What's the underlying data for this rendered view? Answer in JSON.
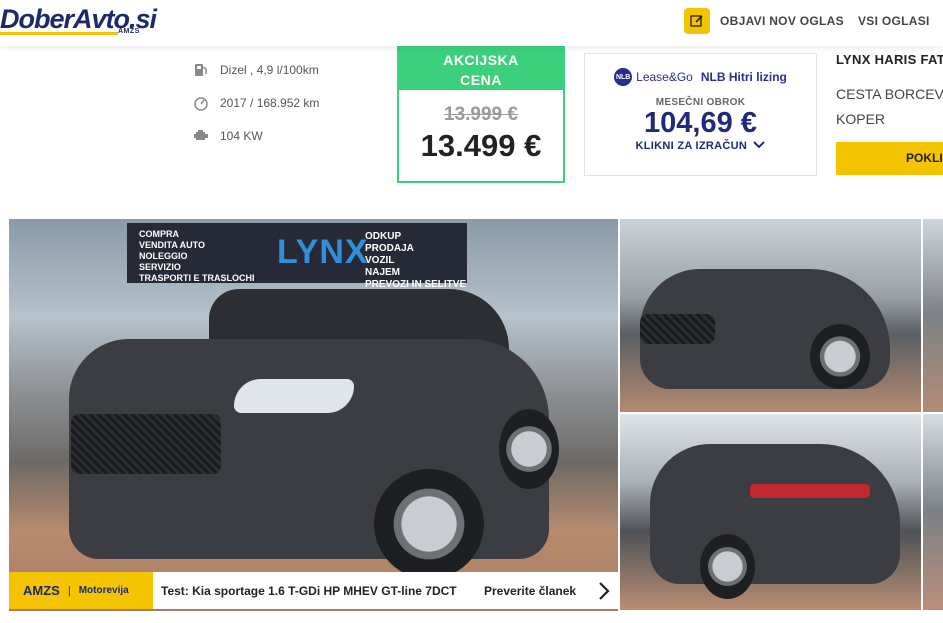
{
  "header": {
    "logo_text": "DoberAvto.si",
    "logo_sub": "AMZS",
    "post_ad_label": "OBJAVI NOV OGLAS",
    "all_ads_label": "VSI OGLASI"
  },
  "specs": [
    {
      "icon": "fuel-pump-icon",
      "text": "Dizel , 4,9 l/100km"
    },
    {
      "icon": "speedometer-icon",
      "text": "2017 / 168.952 km"
    },
    {
      "icon": "engine-icon",
      "text": "104 KW"
    }
  ],
  "price": {
    "promo_line1": "AKCIJSKA",
    "promo_line2": "CENA",
    "old_price": "13.999 €",
    "new_price": "13.499 €"
  },
  "leasing": {
    "brand_logo": "NLB",
    "brand_text": "Lease&Go",
    "product": "NLB Hitri lizing",
    "monthly_label": "MESEČNI OBROK",
    "monthly_amount": "104,69 €",
    "calc_label": "KLIKNI ZA IZRAČUN"
  },
  "dealer": {
    "name": "LYNX HARIS FAT",
    "address_line1": "CESTA BORCEV",
    "address_line2": "KOPER",
    "button_label": "POKLI"
  },
  "billboard": {
    "brand": "LYNX",
    "left_text": "COMPRA\nVENDITA AUTO\nNOLEGGIO\nSERVIZIO\nTRASPORTI E TRASLOCHI",
    "right_text": "ODKUP\nPRODAJA\nVOZIL\nNAJEM\nPREVOZI IN SELITVE"
  },
  "news": {
    "source": "AMZS",
    "separator": "|",
    "source_sub": "Motorevija",
    "title": "Test: Kia sportage 1.6 T-GDi HP MHEV GT-line 7DCT",
    "link_label": "Preverite članek"
  },
  "colors": {
    "brand_yellow": "#f5c400",
    "brand_navy": "#1b2a6b",
    "promo_green": "#3bd07c",
    "nlb_blue": "#2a2f8f"
  }
}
